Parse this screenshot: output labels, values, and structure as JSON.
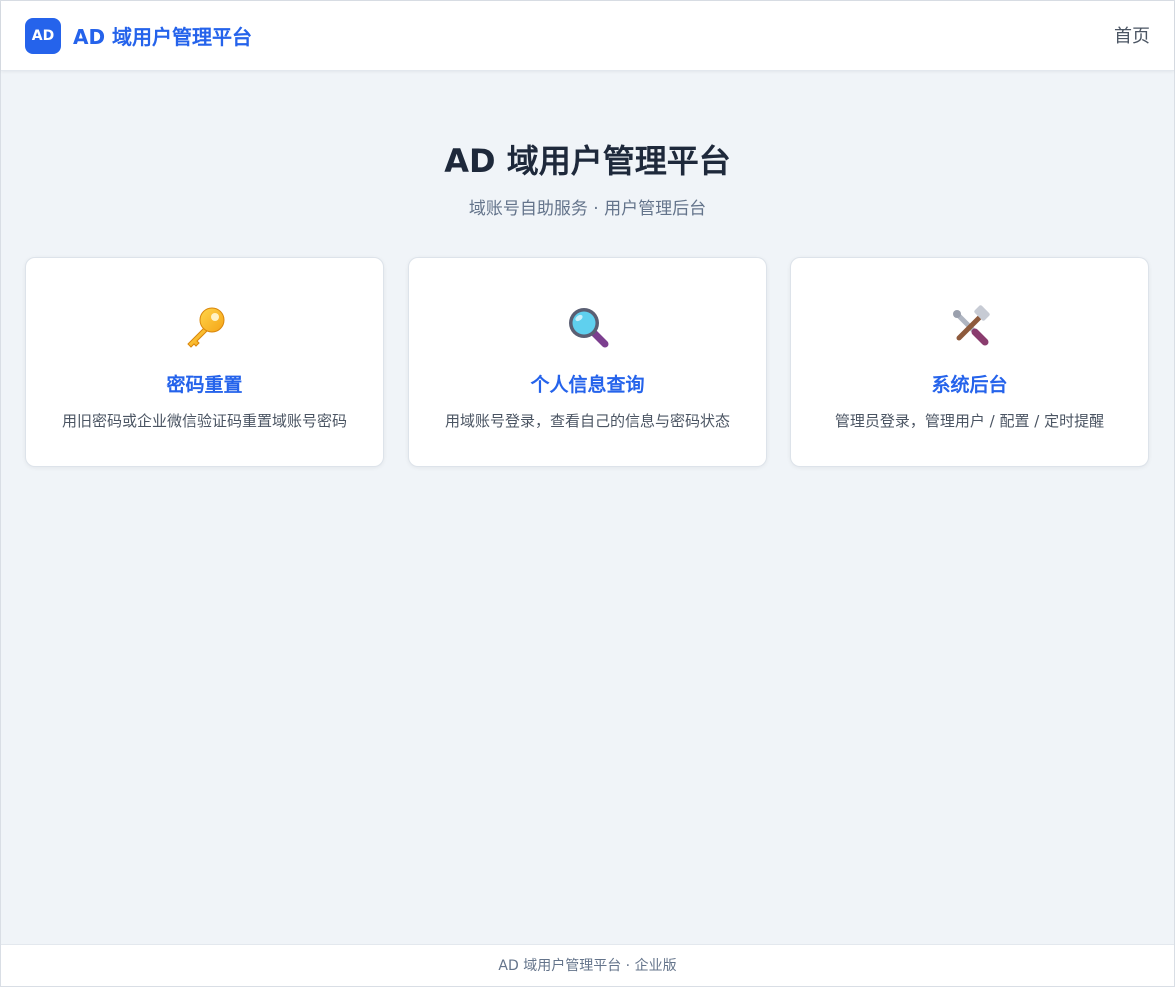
{
  "header": {
    "logo_text": "AD",
    "brand": "AD 域用户管理平台",
    "nav_home": "首页"
  },
  "hero": {
    "title": "AD 域用户管理平台",
    "subtitle": "域账号自助服务 · 用户管理后台"
  },
  "cards": [
    {
      "icon": "key-icon",
      "title": "密码重置",
      "desc": "用旧密码或企业微信验证码重置域账号密码"
    },
    {
      "icon": "magnifier-icon",
      "title": "个人信息查询",
      "desc": "用域账号登录，查看自己的信息与密码状态"
    },
    {
      "icon": "tools-icon",
      "title": "系统后台",
      "desc": "管理员登录，管理用户 / 配置 / 定时提醒"
    }
  ],
  "footer": {
    "text": "AD 域用户管理平台 · 企业版"
  },
  "colors": {
    "accent": "#2563eb",
    "background": "#f0f4f8",
    "title": "#1e293b"
  }
}
